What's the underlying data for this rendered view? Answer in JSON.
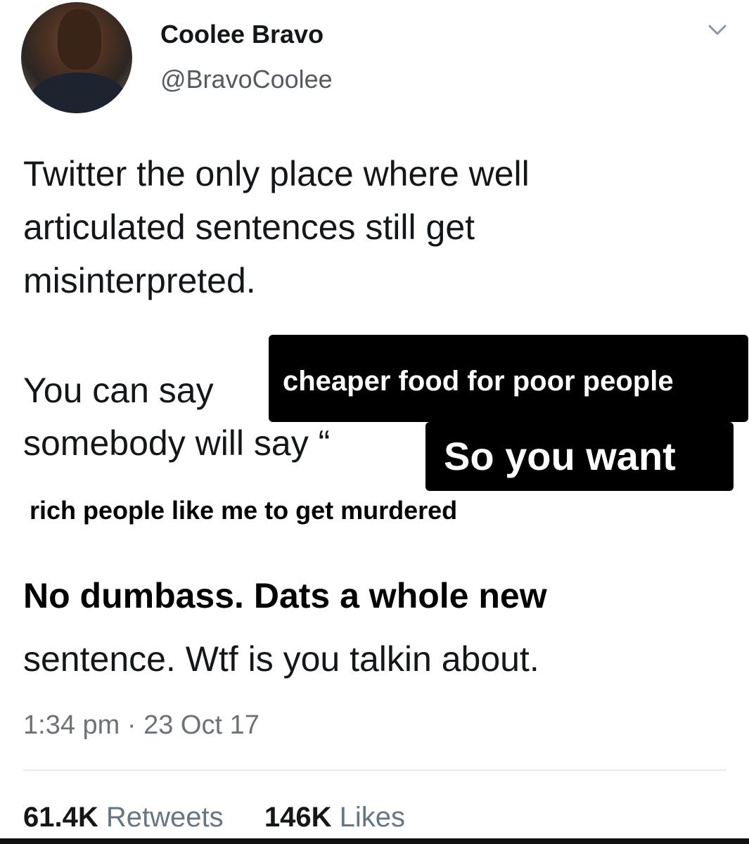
{
  "user": {
    "display_name": "Coolee Bravo",
    "handle": "@BravoCoolee",
    "avatar_icon": "profile-photo"
  },
  "menu_icon": "chevron-down-icon",
  "tweet": {
    "lines": [
      "Twitter the only place where well",
      "articulated sentences still get",
      "misinterpreted.",
      "You can say",
      "somebody will say “"
    ],
    "final_line": "sentence. Wtf is you talkin about."
  },
  "edits": {
    "box1": "cheaper food for poor people",
    "box2": "So you want",
    "caption": "rich people like me to get murdered",
    "bold_line": "No dumbass. Dats a whole new"
  },
  "meta": {
    "timestamp": "1:34 pm · 23 Oct 17"
  },
  "stats": {
    "retweets_count": "61.4K",
    "retweets_label": "Retweets",
    "likes_count": "146K",
    "likes_label": "Likes"
  }
}
